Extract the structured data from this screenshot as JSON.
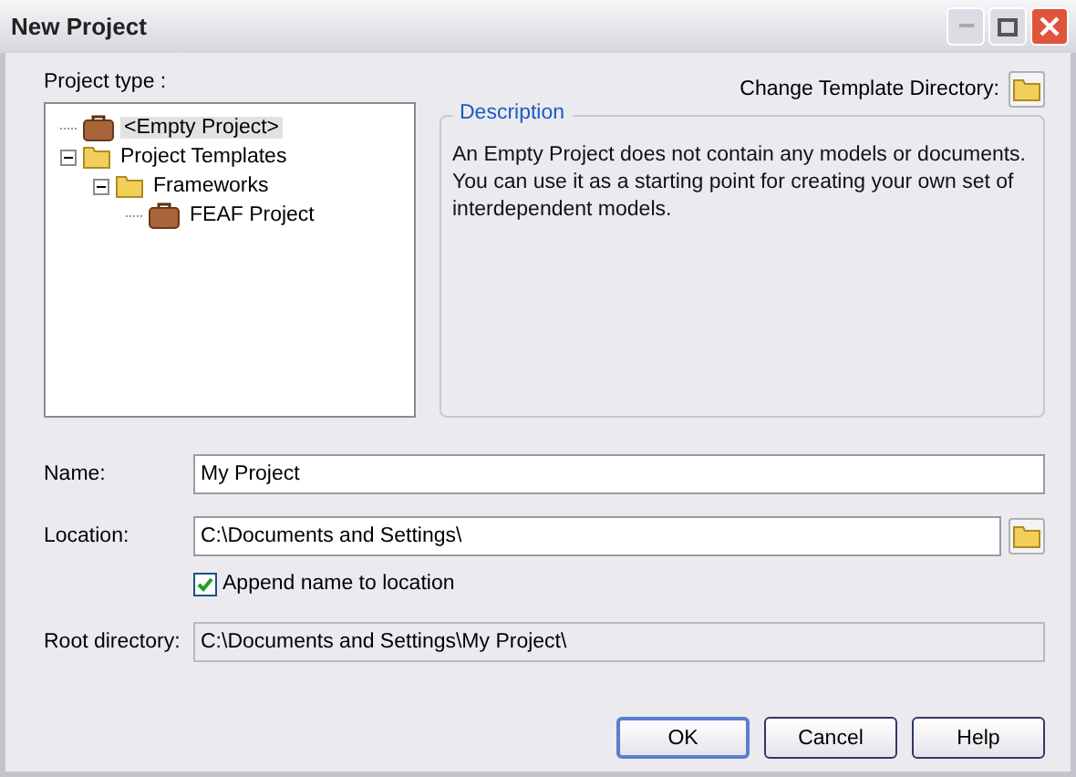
{
  "window": {
    "title": "New Project"
  },
  "project_type": {
    "label": "Project type :",
    "tree": [
      {
        "label": "<Empty Project>",
        "kind": "project",
        "selected": true
      },
      {
        "label": "Project Templates",
        "kind": "folder",
        "selected": false,
        "expanded": true,
        "children": [
          {
            "label": "Frameworks",
            "kind": "folder",
            "selected": false,
            "expanded": true,
            "children": [
              {
                "label": "FEAF Project",
                "kind": "project",
                "selected": false
              }
            ]
          }
        ]
      }
    ]
  },
  "change_template_directory": {
    "label": "Change Template Directory:"
  },
  "description": {
    "title": "Description",
    "text": "An Empty Project does not contain any models or documents. You can use it as a starting point for creating your own set of interdependent models."
  },
  "name": {
    "label": "Name:",
    "value": "My Project"
  },
  "location": {
    "label": "Location:",
    "value": "C:\\Documents and Settings\\"
  },
  "append_name": {
    "label": "Append name to location",
    "checked": true
  },
  "root_directory": {
    "label": "Root directory:",
    "value": "C:\\Documents and Settings\\My Project\\"
  },
  "buttons": [
    {
      "label": "OK",
      "default": true
    },
    {
      "label": "Cancel",
      "default": false
    },
    {
      "label": "Help",
      "default": false
    }
  ]
}
